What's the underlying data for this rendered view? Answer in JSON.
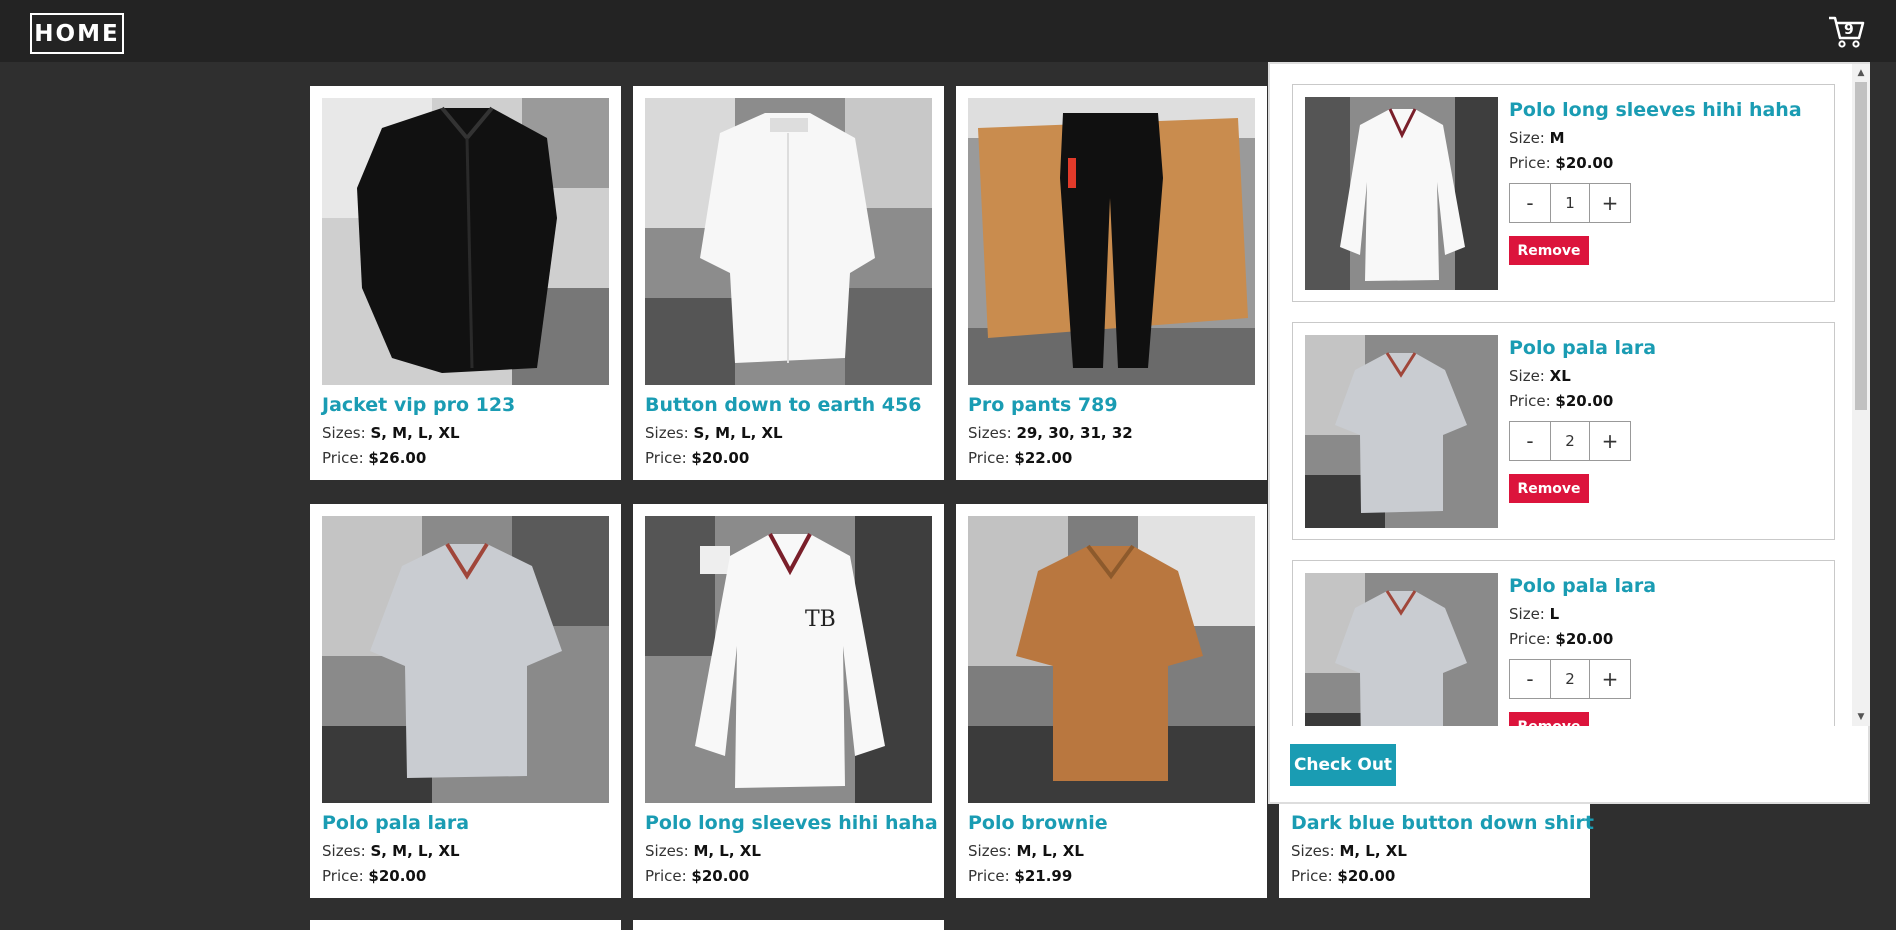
{
  "nav": {
    "home_label": "HOME",
    "cart_count": "9",
    "cart_icon": "cart-icon"
  },
  "products": [
    {
      "name": "Jacket vip pro 123",
      "sizes_label": "Sizes: ",
      "sizes": "S, M, L, XL",
      "price_label": "Price: ",
      "price": "$26.00"
    },
    {
      "name": "Button down to earth 456",
      "sizes_label": "Sizes: ",
      "sizes": "S, M, L, XL",
      "price_label": "Price: ",
      "price": "$20.00"
    },
    {
      "name": "Pro pants 789",
      "sizes_label": "Sizes: ",
      "sizes": "29, 30, 31, 32",
      "price_label": "Price: ",
      "price": "$22.00"
    },
    {
      "name": "Polo pala lara",
      "sizes_label": "Sizes: ",
      "sizes": "S, M, L, XL",
      "price_label": "Price: ",
      "price": "$20.00"
    },
    {
      "name": "Polo long sleeves hihi haha",
      "sizes_label": "Sizes: ",
      "sizes": "M, L, XL",
      "price_label": "Price: ",
      "price": "$20.00"
    },
    {
      "name": "Polo brownie",
      "sizes_label": "Sizes: ",
      "sizes": "M, L, XL",
      "price_label": "Price: ",
      "price": "$21.99"
    },
    {
      "name": "Dark blue button down shirt",
      "sizes_label": "Sizes: ",
      "sizes": "M, L, XL",
      "price_label": "Price: ",
      "price": "$20.00"
    }
  ],
  "cart": {
    "items": [
      {
        "name": "Polo long sleeves hihi haha",
        "size_label": "Size: ",
        "size": "M",
        "price_label": "Price: ",
        "price": "$20.00",
        "qty": "1",
        "minus": "-",
        "plus": "+",
        "remove": "Remove"
      },
      {
        "name": "Polo pala lara",
        "size_label": "Size: ",
        "size": "XL",
        "price_label": "Price: ",
        "price": "$20.00",
        "qty": "2",
        "minus": "-",
        "plus": "+",
        "remove": "Remove"
      },
      {
        "name": "Polo pala lara",
        "size_label": "Size: ",
        "size": "L",
        "price_label": "Price: ",
        "price": "$20.00",
        "qty": "2",
        "minus": "-",
        "plus": "+",
        "remove": "Remove"
      }
    ],
    "checkout_label": "Check Out"
  },
  "colors": {
    "accent": "#1a9cb3",
    "remove": "#dc143c",
    "page_bg": "#2f2f2f",
    "nav_bg": "#232323"
  }
}
